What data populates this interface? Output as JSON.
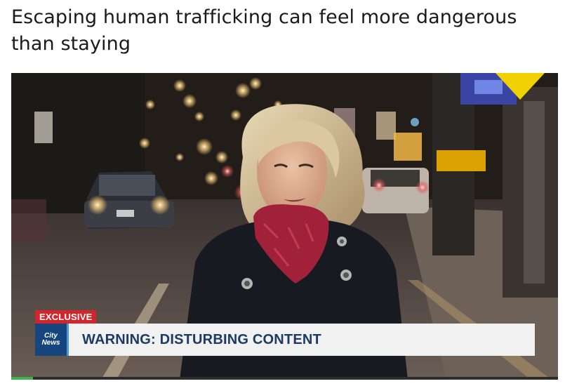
{
  "article": {
    "headline": "Escaping human trafficking can feel more dangerous than staying"
  },
  "video": {
    "exclusive_label": "EXCLUSIVE",
    "logo_line1": "City",
    "logo_line2": "News",
    "banner_text": "WARNING: DISTURBING CONTENT",
    "progress": 0.04,
    "colors": {
      "exclusive_red": "#d2262c",
      "logo_blue": "#16467d",
      "banner_text": "#1d3a63",
      "progress_green": "#3bb54a"
    }
  }
}
